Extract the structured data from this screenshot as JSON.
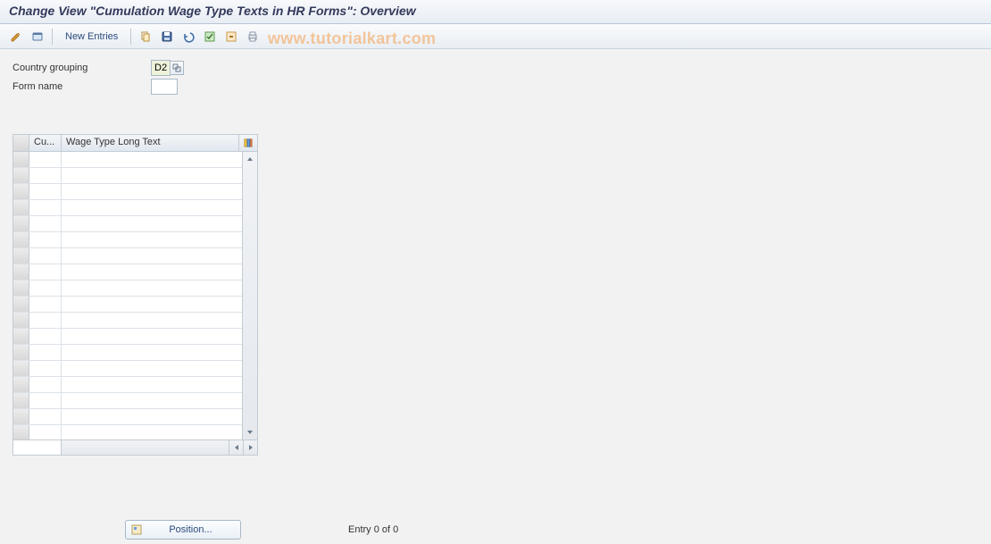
{
  "title": "Change View \"Cumulation Wage Type Texts in HR Forms\": Overview",
  "toolbar": {
    "new_entries": "New Entries"
  },
  "form": {
    "country_grouping_label": "Country grouping",
    "country_grouping_value": "D2",
    "form_name_label": "Form name",
    "form_name_value": ""
  },
  "table": {
    "col_cu": "Cu...",
    "col_wt": "Wage Type Long Text",
    "row_count": 18
  },
  "bottom": {
    "position_label": "Position...",
    "entry_text": "Entry 0 of 0"
  },
  "watermark": "www.tutorialkart.com"
}
